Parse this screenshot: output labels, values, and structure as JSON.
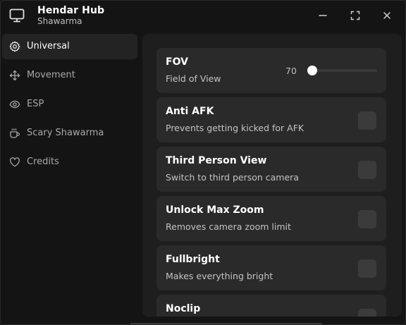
{
  "app": {
    "title": "Hendar Hub",
    "subtitle": "Shawarma",
    "icon": "monitor-icon"
  },
  "window_controls": [
    "minimize-icon",
    "maximize-icon",
    "close-icon"
  ],
  "sidebar": {
    "items": [
      {
        "label": "Universal",
        "icon": "gear-icon",
        "active": true
      },
      {
        "label": "Movement",
        "icon": "move-arrows-icon",
        "active": false
      },
      {
        "label": "ESP",
        "icon": "eye-icon",
        "active": false
      },
      {
        "label": "Scary Shawarma",
        "icon": "cup-icon",
        "active": false
      },
      {
        "label": "Credits",
        "icon": "heart-icon",
        "active": false
      }
    ]
  },
  "main": {
    "fov": {
      "title": "FOV",
      "description": "Field of View",
      "value": "70",
      "slider_fraction": 0.0
    },
    "toggles": [
      {
        "title": "Anti AFK",
        "description": "Prevents getting kicked for AFK",
        "enabled": false
      },
      {
        "title": "Third Person View",
        "description": "Switch to third person camera",
        "enabled": false
      },
      {
        "title": "Unlock Max Zoom",
        "description": "Removes camera zoom limit",
        "enabled": false
      },
      {
        "title": "Fullbright",
        "description": "Makes everything bright",
        "enabled": false
      },
      {
        "title": "Noclip",
        "description": "",
        "enabled": false
      }
    ]
  },
  "colors": {
    "background": "#141414",
    "panel": "#1e1e1e",
    "card": "#2a2a2a",
    "active_nav": "#232323",
    "text_primary": "#ffffff",
    "text_secondary": "#a8a8a8",
    "toggle_off": "#3b3b3b"
  }
}
